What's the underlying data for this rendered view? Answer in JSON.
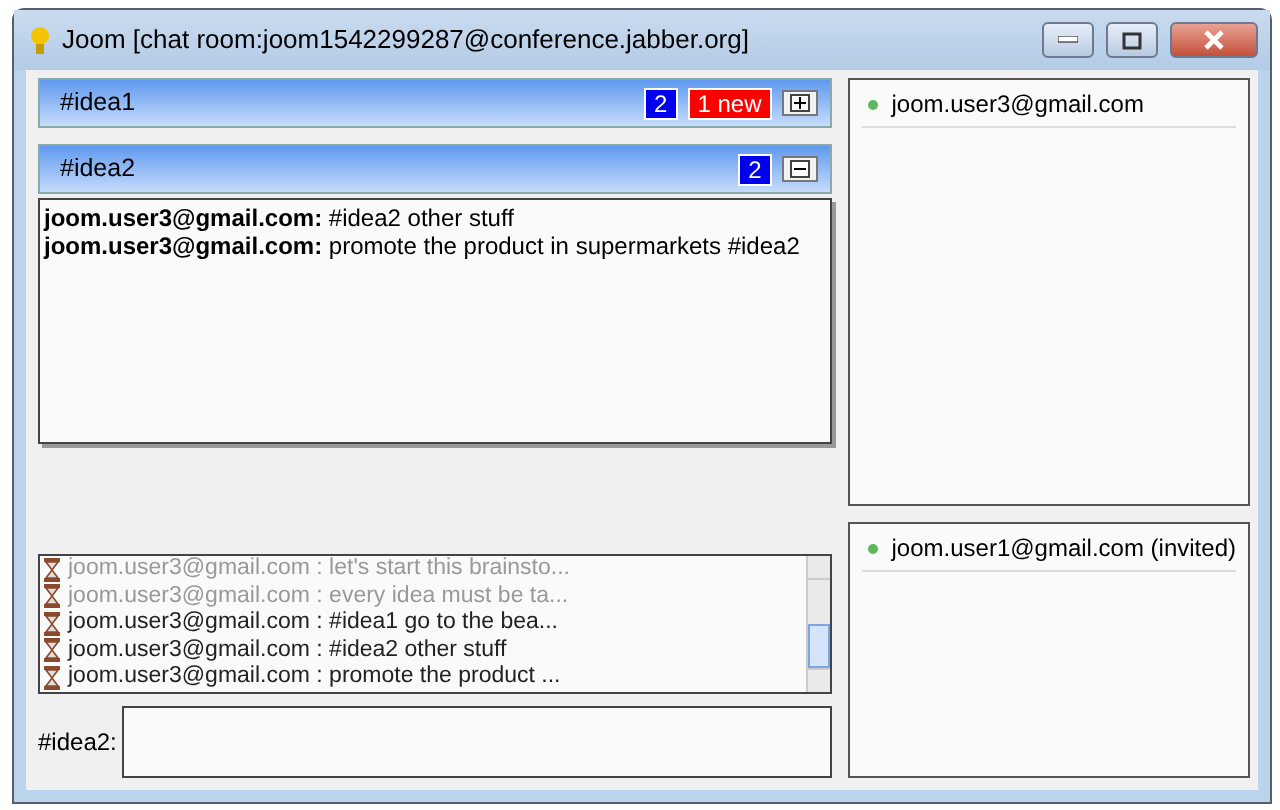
{
  "window": {
    "title": "Joom [chat room:joom1542299287@conference.jabber.org]"
  },
  "topics": [
    {
      "name": "#idea1",
      "count": "2",
      "new_badge": "1 new",
      "expanded": false
    },
    {
      "name": "#idea2",
      "count": "2",
      "expanded": true,
      "messages": [
        "**joom.user3@gmail.com:** #idea2 other stuff",
        "**joom.user3@gmail.com:** promote the product in supermarkets #idea2"
      ]
    }
  ],
  "log": [
    {
      "text": "joom.user3@gmail.com : let's start this brainsto...",
      "dimmed": true
    },
    {
      "text": "joom.user3@gmail.com : every idea must be ta...",
      "dimmed": true
    },
    {
      "text": "joom.user3@gmail.com : #idea1 go to the bea...",
      "dimmed": false
    },
    {
      "text": "joom.user3@gmail.com : #idea2 other stuff",
      "dimmed": false
    },
    {
      "text": "joom.user3@gmail.com : promote the product ...",
      "dimmed": false
    }
  ],
  "input": {
    "label": "#idea2:"
  },
  "participants": [
    {
      "name": "joom.user3@gmail.com"
    }
  ],
  "invited": [
    {
      "name": "joom.user1@gmail.com (invited)"
    }
  ]
}
